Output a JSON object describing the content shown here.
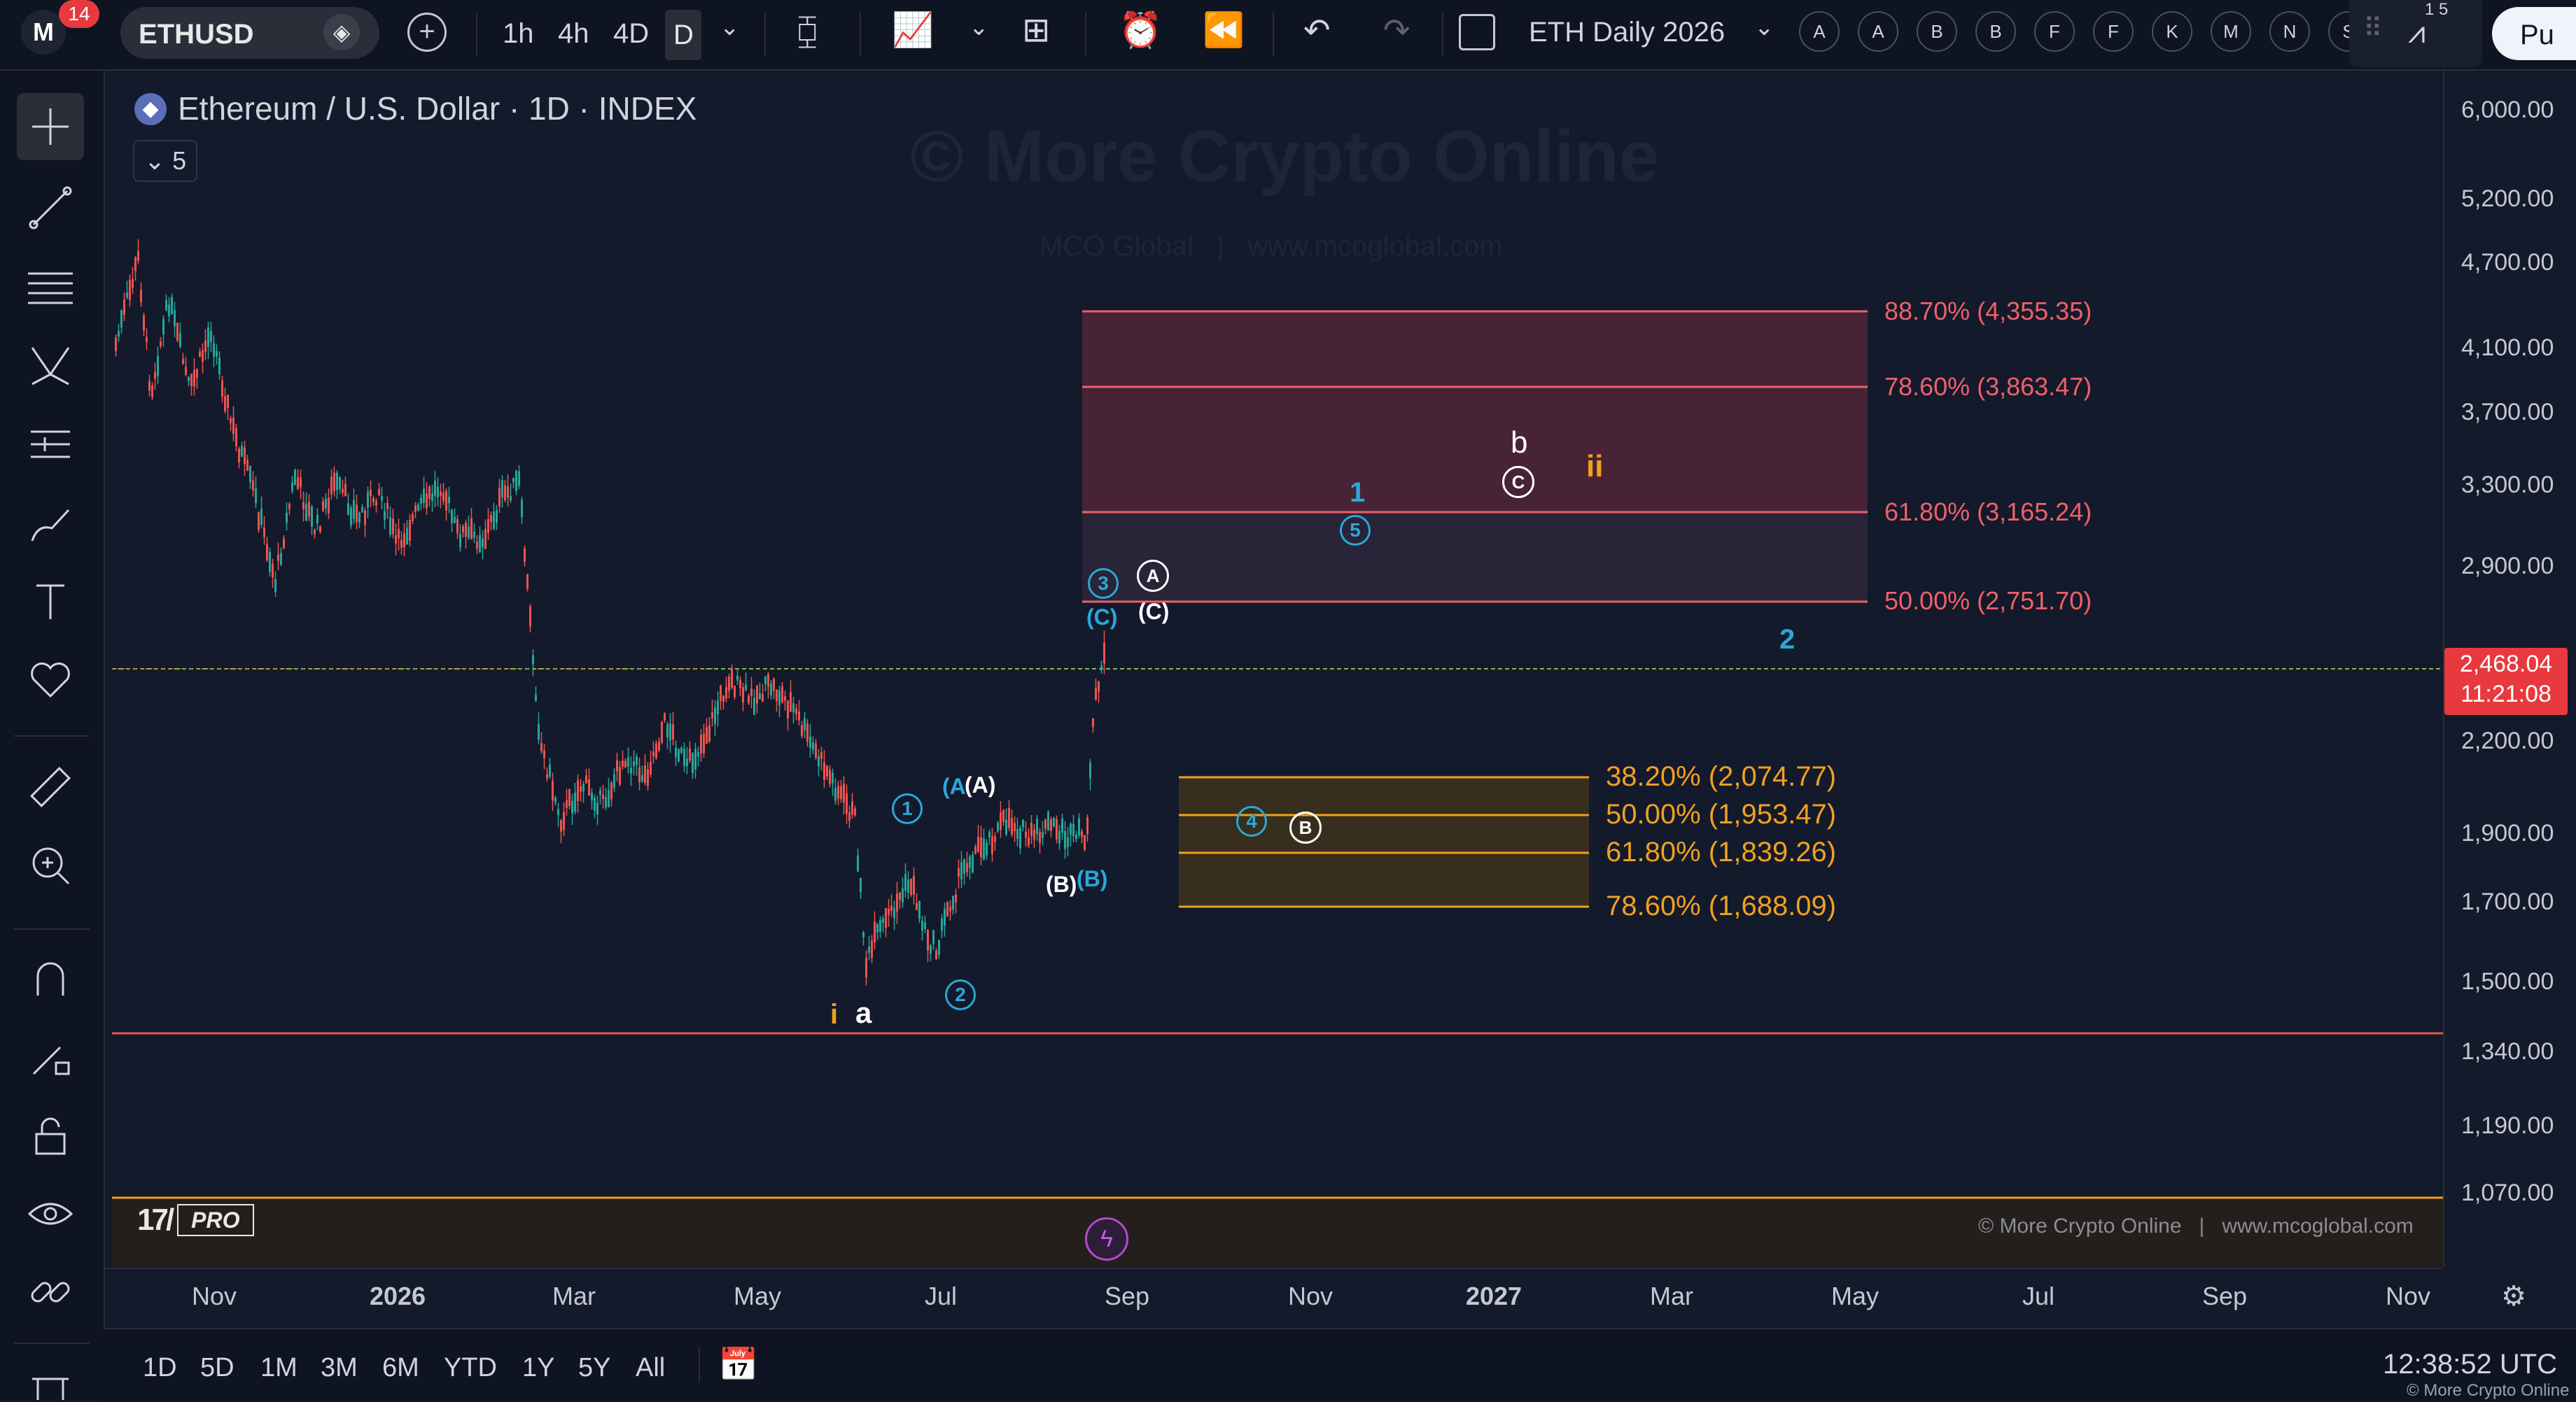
{
  "toolbar": {
    "badge": "14",
    "symbol": "ETHUSD",
    "timeframes": [
      "1h",
      "4h",
      "4D",
      "D"
    ],
    "layout_name": "ETH Daily 2026",
    "alert_buttons": [
      "A",
      "A",
      "B",
      "B",
      "F",
      "F",
      "K",
      "M",
      "N",
      "S"
    ],
    "counter_top": "1 5",
    "publish": "Pu"
  },
  "chart": {
    "title": "Ethereum / U.S. Dollar · 1D · INDEX",
    "indicators_count": "5",
    "watermark": "© More Crypto Online",
    "watermark_sub": "MCO Global   |   www.mcoglobal.com",
    "footer_credit": "© More Crypto Online   |   www.mcoglobal.com",
    "tv_logo": "PRO",
    "current_price": "2,468.04",
    "countdown": "11:21:08",
    "price_axis": [
      "6,000.00",
      "5,200.00",
      "4,700.00",
      "4,100.00",
      "3,700.00",
      "3,300.00",
      "2,900.00",
      "2,200.00",
      "1,900.00",
      "1,700.00",
      "1,500.00",
      "1,340.00",
      "1,190.00",
      "1,070.00"
    ],
    "time_axis": [
      "Nov",
      "2026",
      "Mar",
      "May",
      "Jul",
      "Sep",
      "Nov",
      "2027",
      "Mar",
      "May",
      "Jul",
      "Sep",
      "Nov"
    ],
    "fib_resistance": [
      "88.70% (4,355.35)",
      "78.60% (3,863.47)",
      "61.80% (3,165.24)",
      "50.00% (2,751.70)"
    ],
    "fib_support": [
      "38.20% (2,074.77)",
      "50.00% (1,953.47)",
      "61.80% (1,839.26)",
      "78.60% (1,688.09)"
    ],
    "waves": {
      "i": "i",
      "a": "a",
      "w1": "1",
      "w2": "2",
      "w3": "3",
      "w4": "4",
      "w5": "5",
      "A_blue": "(A",
      "A_white": "(A)",
      "B_white": "(B)",
      "B_blue": "(B)",
      "C_blue": "(C)",
      "C_white": "(C)",
      "A_circ": "A",
      "B_circ": "B",
      "C_circ": "C",
      "b": "b",
      "ii": "ii",
      "big1": "1",
      "big2": "2"
    },
    "colors": {
      "bg": "#131a2b",
      "up": "#26a69a",
      "down": "#ef5350",
      "resistance": "#f0606a",
      "support": "#f0a020",
      "wave_blue": "#29a8d8"
    }
  },
  "bottom": {
    "ranges": [
      "1D",
      "5D",
      "1M",
      "3M",
      "6M",
      "YTD",
      "1Y",
      "5Y",
      "All"
    ],
    "clock": "12:38:52 UTC",
    "credit": "© More Crypto Online"
  }
}
